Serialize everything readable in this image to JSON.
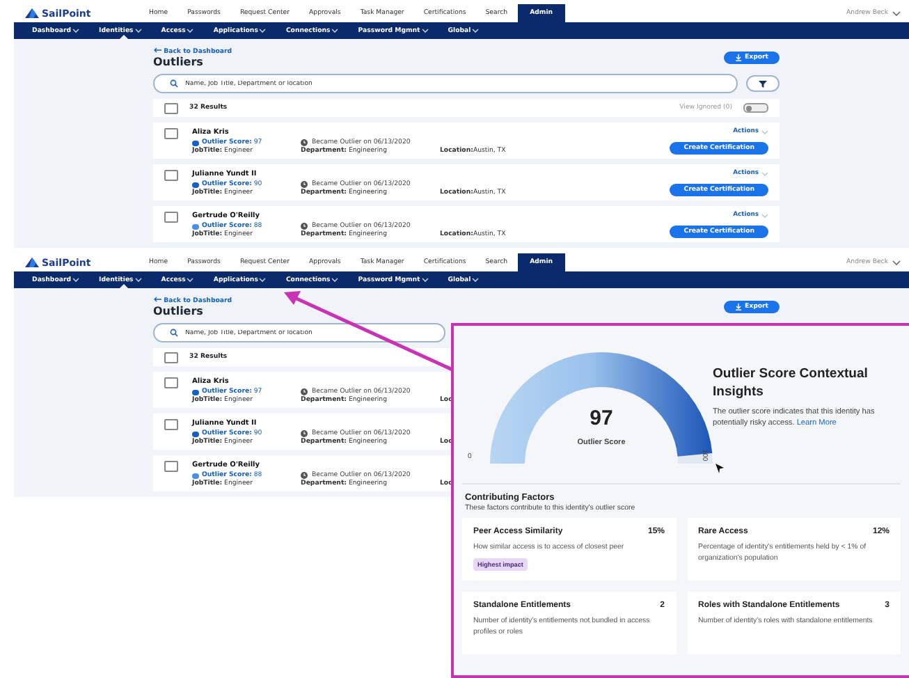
{
  "screens": [
    {
      "logo": "SailPoint",
      "nav": [
        {
          "label": "Home",
          "selected": false
        },
        {
          "label": "Passwords",
          "selected": false
        },
        {
          "label": "Request Center",
          "selected": false
        },
        {
          "label": "Approvals",
          "selected": false
        },
        {
          "label": "Task Manager",
          "selected": false
        },
        {
          "label": "Certifications",
          "selected": false
        },
        {
          "label": "Search",
          "selected": false
        },
        {
          "label": "Admin",
          "selected": true
        }
      ],
      "user": "Andrew Beck",
      "subnav": [
        {
          "label": "Dashboard",
          "selected": false
        },
        {
          "label": "Identities",
          "selected": true
        },
        {
          "label": "Access",
          "selected": false
        },
        {
          "label": "Applications",
          "selected": false
        },
        {
          "label": "Connections",
          "selected": false
        },
        {
          "label": "Password Mgmnt",
          "selected": false
        },
        {
          "label": "Global",
          "selected": false
        }
      ],
      "back_link": "Back to Dashboard",
      "title": "Outliers",
      "export_button": "Export",
      "search": {
        "placeholder": "Name, Job Title, Department or location"
      },
      "results": "32 Results",
      "results_checked": false,
      "view_ignored": {
        "label": "View Ignored (0)",
        "on": false
      },
      "rows": [
        {
          "name": "Aliza Kris",
          "checked": false,
          "score_label": "Outlier Score:",
          "score": "97",
          "color": "#1560c0",
          "became": "Became Outlier on 06/13/2020",
          "job_title": {
            "label": "JobTitle:",
            "value": "Engineer"
          },
          "department": {
            "label": "Department:",
            "value": "Engineering"
          },
          "location": {
            "label": "Location:",
            "value": "Austin, TX"
          },
          "actions": "Actions",
          "action_button": "Create Certification"
        },
        {
          "name": "Julianne Yundt II",
          "checked": false,
          "score_label": "Outlier Score:",
          "score": "90",
          "color": "#1560c0",
          "became": "Became Outlier on 06/13/2020",
          "job_title": {
            "label": "JobTitle:",
            "value": "Engineer"
          },
          "department": {
            "label": "Department:",
            "value": "Engineering"
          },
          "location": {
            "label": "Location:",
            "value": "Austin, TX"
          },
          "actions": "Actions",
          "action_button": "Create Certification"
        },
        {
          "name": "Gertrude O'Reilly",
          "checked": false,
          "score_label": "Outlier Score:",
          "score": "88",
          "color": "#4a90e2",
          "became": "Became Outlier on 06/13/2020",
          "job_title": {
            "label": "JobTitle:",
            "value": "Engineer"
          },
          "department": {
            "label": "Department:",
            "value": "Engineering"
          },
          "location": {
            "label": "Location:",
            "value": "Austin, TX"
          },
          "actions": "Actions",
          "action_button": "Create Certification"
        }
      ]
    },
    {
      "logo": "SailPoint",
      "nav": [
        {
          "label": "Home",
          "selected": false
        },
        {
          "label": "Passwords",
          "selected": false
        },
        {
          "label": "Request Center",
          "selected": false
        },
        {
          "label": "Approvals",
          "selected": false
        },
        {
          "label": "Task Manager",
          "selected": false
        },
        {
          "label": "Certifications",
          "selected": false
        },
        {
          "label": "Search",
          "selected": false
        },
        {
          "label": "Admin",
          "selected": true
        }
      ],
      "user": "Andrew Beck",
      "subnav": [
        {
          "label": "Dashboard",
          "selected": false
        },
        {
          "label": "Identities",
          "selected": true
        },
        {
          "label": "Access",
          "selected": false
        },
        {
          "label": "Applications",
          "selected": false
        },
        {
          "label": "Connections",
          "selected": false
        },
        {
          "label": "Password Mgmnt",
          "selected": false
        },
        {
          "label": "Global",
          "selected": false
        }
      ],
      "back_link": "Back to Dashboard",
      "title": "Outliers",
      "export_button": "Export",
      "search": {
        "placeholder": "Name, Job Title, Department or location"
      },
      "results": "32 Results",
      "results_checked": false,
      "rows": [
        {
          "name": "Aliza Kris",
          "checked": false,
          "score_label": "Outlier Score:",
          "score": "97",
          "color": "#1560c0",
          "became": "Became Outlier on 06/13/2020",
          "job_title": {
            "label": "JobTitle:",
            "value": "Engineer"
          },
          "department": {
            "label": "Department:",
            "value": "Engineering"
          },
          "location": {
            "label": "Loc"
          }
        },
        {
          "name": "Julianne Yundt II",
          "checked": false,
          "score_label": "Outlier Score:",
          "score": "90",
          "color": "#1560c0",
          "became": "Became Outlier on 06/13/2020",
          "job_title": {
            "label": "JobTitle:",
            "value": "Engineer"
          },
          "department": {
            "label": "Department:",
            "value": "Engineering"
          },
          "location": {
            "label": "Loc"
          }
        },
        {
          "name": "Gertrude O'Reilly",
          "checked": false,
          "score_label": "Outlier Score:",
          "score": "88",
          "color": "#4a90e2",
          "became": "Became Outlier on 06/13/2020",
          "job_title": {
            "label": "JobTitle:",
            "value": "Engineer"
          },
          "department": {
            "label": "Department:",
            "value": "Engineering"
          },
          "location": {
            "label": "Loc"
          }
        }
      ]
    }
  ],
  "insights_panel": {
    "gauge": {
      "value": "97",
      "caption": "Outlier Score",
      "min": "0",
      "max": "100",
      "level": 0.97
    },
    "title": "Outlier Score Contextual Insights",
    "text": "The outlier score indicates that this identity has potentially risky access.",
    "link": "Learn More",
    "factors_title": "Contributing Factors",
    "factors_subtitle": "These factors contribute to this identity's outlier score",
    "factors": [
      {
        "title": "Peer Access Similarity",
        "value": "15%",
        "description": "How similar access is to access of closest peer",
        "badge": "Highest impact"
      },
      {
        "title": "Rare Access",
        "value": "12%",
        "description": "Percentage of identity's entitlements held by < 1% of organization's population"
      },
      {
        "title": "Standalone Entitlements",
        "value": "2",
        "description": "Number of identity's entitlements not bundled in access profiles or roles"
      },
      {
        "title": "Roles with Standalone Entitlements",
        "value": "3",
        "description": "Number of identity's roles with standalone entitlements"
      }
    ]
  }
}
